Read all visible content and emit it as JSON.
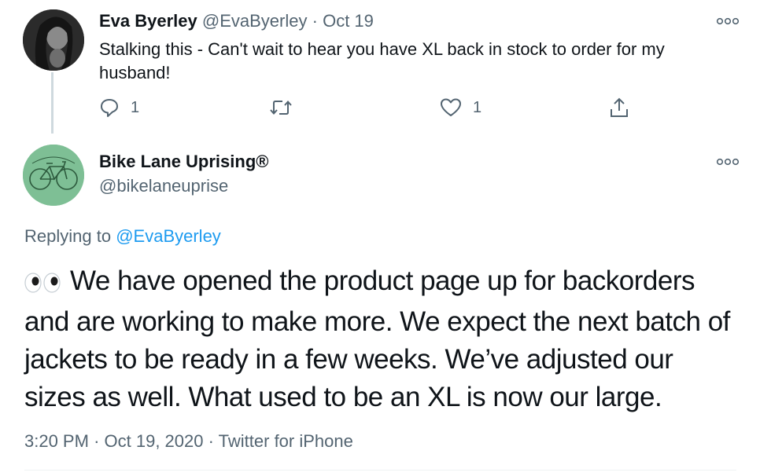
{
  "reply_tweet": {
    "name": "Eva Byerley",
    "handle": "@EvaByerley",
    "separator": "·",
    "date": "Oct 19",
    "text": "Stalking this - Can't wait to hear you have XL back in stock to order for my husband!",
    "actions": {
      "reply_icon": "reply-icon",
      "reply_count": "1",
      "retweet_icon": "retweet-icon",
      "like_icon": "heart-icon",
      "like_count": "1",
      "share_icon": "share-icon"
    }
  },
  "main_tweet": {
    "name": "Bike Lane Uprising®",
    "handle": "@bikelaneuprise",
    "replying_prefix": "Replying to",
    "replying_to": "@EvaByerley",
    "emoji": "👀",
    "text": "We have opened the product page up for backorders and are working to make more. We expect the next batch of jackets to be ready in a few weeks. We’ve adjusted our sizes as well. What used to be an XL is now our large.",
    "time": "3:20 PM",
    "date": "Oct 19, 2020",
    "source": "Twitter for iPhone",
    "separator": "·"
  },
  "colors": {
    "text": "#0f1419",
    "muted": "#536471",
    "link": "#1d9bf0",
    "avatar_green": "#7ebf95"
  }
}
